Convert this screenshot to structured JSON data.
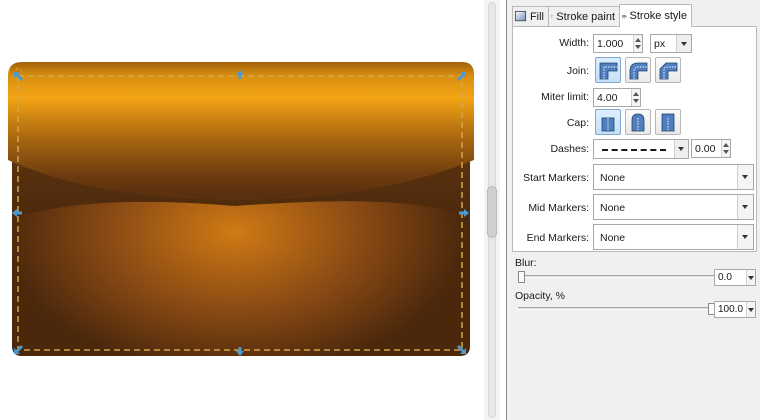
{
  "tabs": [
    {
      "label": "Fill",
      "icon": "fill-swatch-icon"
    },
    {
      "label": "Stroke paint",
      "icon": "stroke-paint-swatch-icon"
    },
    {
      "label": "Stroke style",
      "icon": "stroke-style-icon"
    }
  ],
  "active_tab": "Stroke style",
  "stroke_style": {
    "width_label": "Width:",
    "width_value": "1.000",
    "unit": "px",
    "join_label": "Join:",
    "join_options": [
      "miter-join",
      "round-join",
      "bevel-join"
    ],
    "join_selected": "miter-join",
    "miter_label": "Miter limit:",
    "miter_value": "4.00",
    "cap_label": "Cap:",
    "cap_options": [
      "butt-cap",
      "round-cap",
      "square-cap"
    ],
    "cap_selected": "butt-cap",
    "dashes_label": "Dashes:",
    "dash_offset": "0.00",
    "start_markers_label": "Start Markers:",
    "start_markers_value": "None",
    "mid_markers_label": "Mid Markers:",
    "mid_markers_value": "None",
    "end_markers_label": "End Markers:",
    "end_markers_value": "None"
  },
  "blur": {
    "label": "Blur:",
    "value": "0.0",
    "level_fraction": 0.0
  },
  "opacity": {
    "label": "Opacity, %",
    "value": "100.0",
    "level_fraction": 1.0
  },
  "colors": {
    "flap_light": "#f0a21a",
    "flap_dark": "#5a300f",
    "body_center": "#c87614",
    "body_dark": "#4e2a0d",
    "selection_dash": "#d5a54a",
    "handle": "#4a9ad4"
  }
}
